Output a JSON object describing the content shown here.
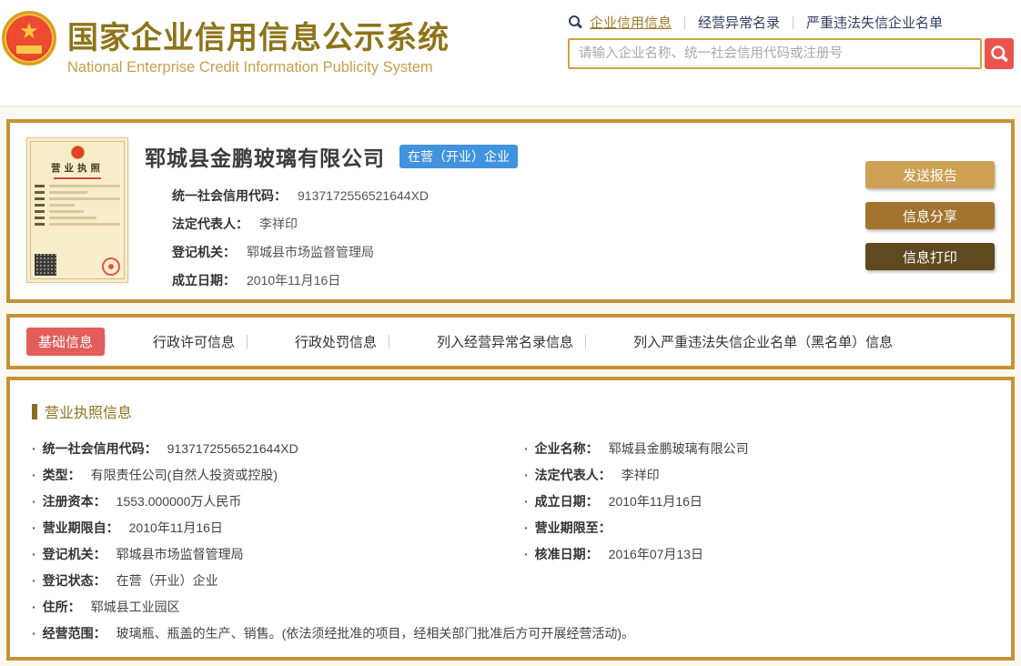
{
  "colors": {
    "gold-border": "#C59336",
    "title-gold": "#8E7419",
    "subtitle-gold": "#C6A04C",
    "link-gold": "#9C7C2C",
    "navy": "#2F3E62",
    "search-red": "#E9544E",
    "badge-blue": "#4293DE",
    "tab-active-red": "#E35D5B",
    "section-gold": "#8F7420",
    "page-bg": "#FAF8F0"
  },
  "header": {
    "site_title_cn": "国家企业信用信息公示系统",
    "site_title_en": "National Enterprise Credit Information Publicity System",
    "search_tabs": [
      {
        "label": "企业信用信息",
        "active": true
      },
      {
        "label": "经营异常名录",
        "active": false
      },
      {
        "label": "严重违法失信企业名单",
        "active": false
      }
    ],
    "search": {
      "placeholder": "请输入企业名称、统一社会信用代码或注册号",
      "value": ""
    }
  },
  "summary": {
    "license_title": "营业执照",
    "company_name": "郓城县金鹏玻璃有限公司",
    "status_badge": "在营（开业）企业",
    "fields": [
      {
        "label": "统一社会信用代码：",
        "value": "9137172556521644XD"
      },
      {
        "label": "法定代表人：",
        "value": "李祥印"
      },
      {
        "label": "登记机关：",
        "value": "郓城县市场监督管理局"
      },
      {
        "label": "成立日期：",
        "value": "2010年11月16日"
      }
    ],
    "buttons": [
      {
        "label": "发送报告",
        "color": "#CDA055"
      },
      {
        "label": "信息分享",
        "color": "#A3742F"
      },
      {
        "label": "信息打印",
        "color": "#5E4A1E"
      }
    ]
  },
  "tabs": [
    {
      "label": "基础信息",
      "active": true
    },
    {
      "label": "行政许可信息",
      "active": false
    },
    {
      "label": "行政处罚信息",
      "active": false
    },
    {
      "label": "列入经营异常名录信息",
      "active": false
    },
    {
      "label": "列入严重违法失信企业名单（黑名单）信息",
      "active": false
    }
  ],
  "details": {
    "section_title": "营业执照信息",
    "fields": [
      {
        "label": "统一社会信用代码：",
        "value": "9137172556521644XD",
        "col": "left"
      },
      {
        "label": "企业名称：",
        "value": "郓城县金鹏玻璃有限公司",
        "col": "right"
      },
      {
        "label": "类型：",
        "value": "有限责任公司(自然人投资或控股)",
        "col": "left"
      },
      {
        "label": "法定代表人：",
        "value": "李祥印",
        "col": "right"
      },
      {
        "label": "注册资本：",
        "value": "1553.000000万人民币",
        "col": "left"
      },
      {
        "label": "成立日期：",
        "value": "2010年11月16日",
        "col": "right"
      },
      {
        "label": "营业期限自：",
        "value": "2010年11月16日",
        "col": "left"
      },
      {
        "label": "营业期限至：",
        "value": "",
        "col": "right"
      },
      {
        "label": "登记机关：",
        "value": "郓城县市场监督管理局",
        "col": "left"
      },
      {
        "label": "核准日期：",
        "value": "2016年07月13日",
        "col": "right"
      },
      {
        "label": "登记状态：",
        "value": "在营（开业）企业",
        "col": "left"
      },
      {
        "label": "住所：",
        "value": "郓城县工业园区",
        "col": "full"
      },
      {
        "label": "经营范围：",
        "value": "玻璃瓶、瓶盖的生产、销售。(依法须经批准的项目，经相关部门批准后方可开展经营活动)。",
        "col": "full"
      }
    ]
  }
}
